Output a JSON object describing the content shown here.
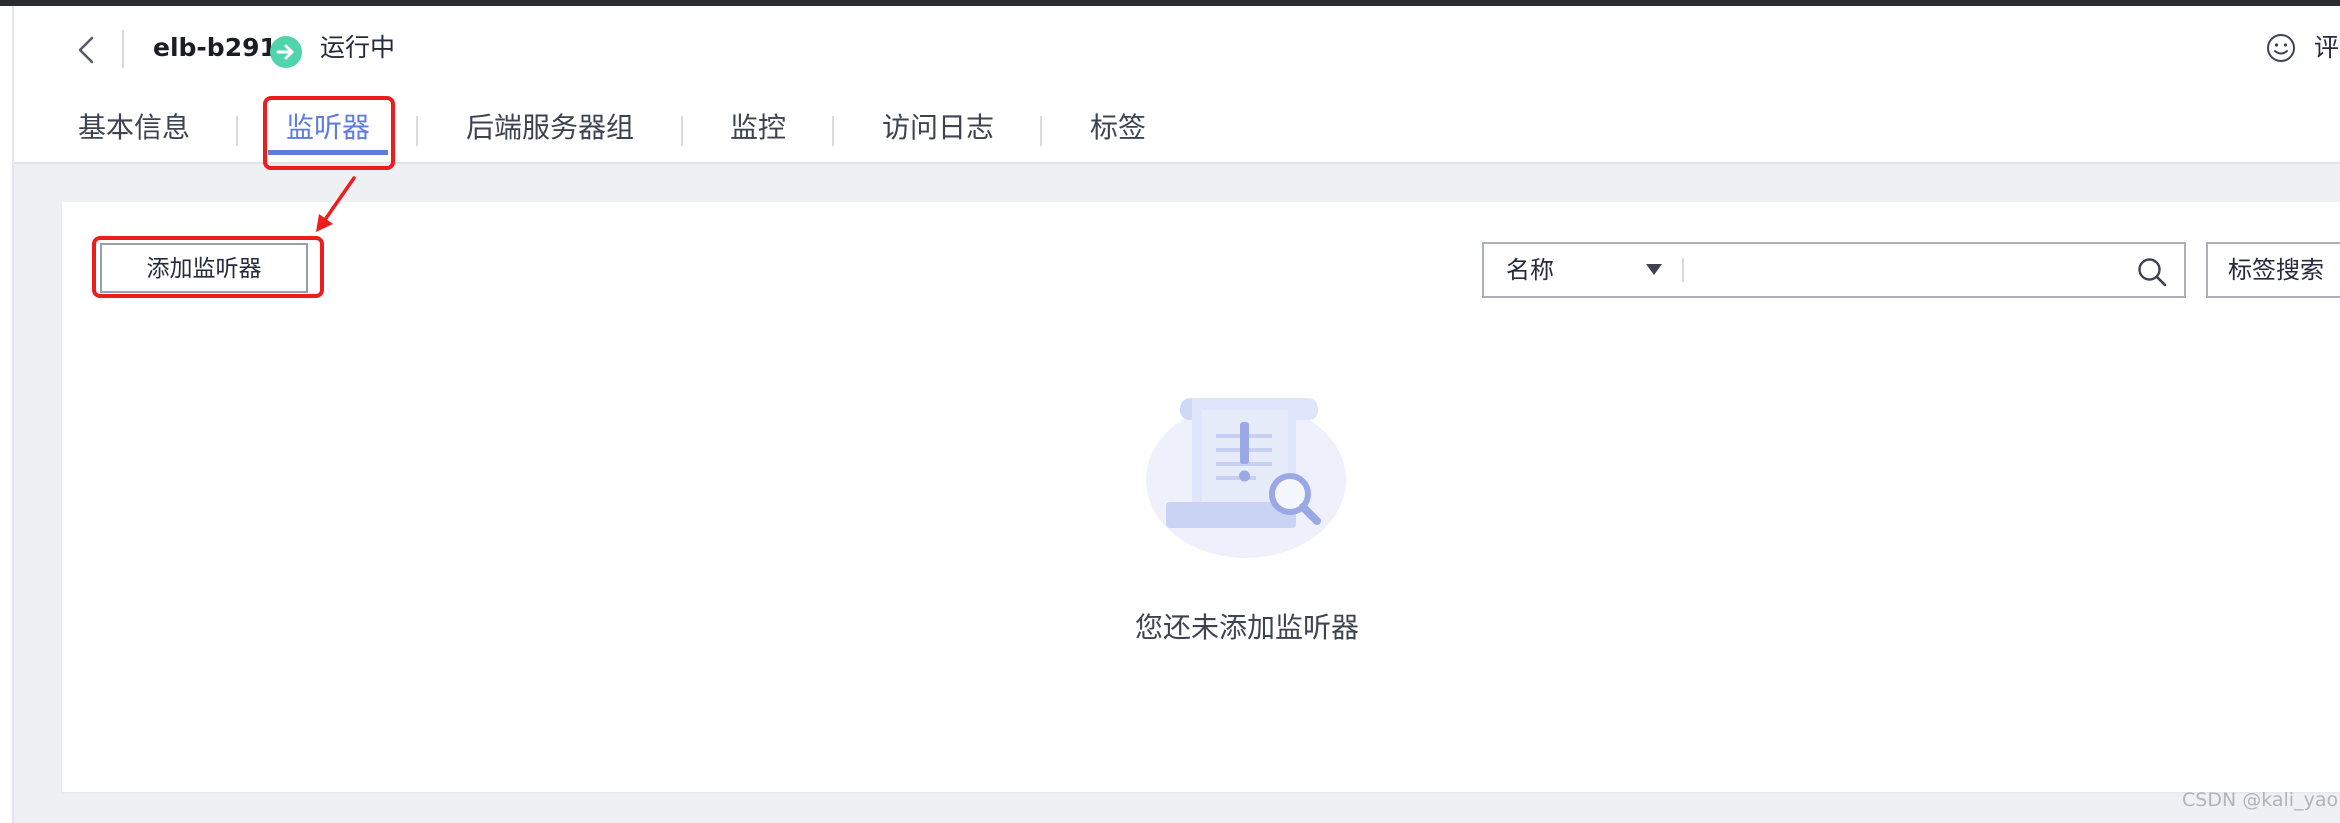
{
  "header": {
    "lb_name": "elb-b291",
    "status": "运行中",
    "feedback_label": "评"
  },
  "tabs": [
    {
      "label": "基本信息"
    },
    {
      "label": "监听器",
      "active": true
    },
    {
      "label": "后端服务器组"
    },
    {
      "label": "监控"
    },
    {
      "label": "访问日志"
    },
    {
      "label": "标签"
    }
  ],
  "toolbar": {
    "add_listener_label": "添加监听器",
    "search_field_selected": "名称",
    "search_value": "",
    "tag_search_label": "标签搜索"
  },
  "empty_state": {
    "message": "您还未添加监听器"
  },
  "watermark": "CSDN @kali_yao",
  "colors": {
    "accent": "#5e7ce0",
    "status_running": "#50d4ab",
    "annotation_red": "#ee1d1d"
  },
  "icons": {
    "back": "chevron-left-icon",
    "status": "arrow-right-circle-icon",
    "feedback": "smile-icon",
    "dropdown": "caret-down-icon",
    "search": "search-icon"
  }
}
